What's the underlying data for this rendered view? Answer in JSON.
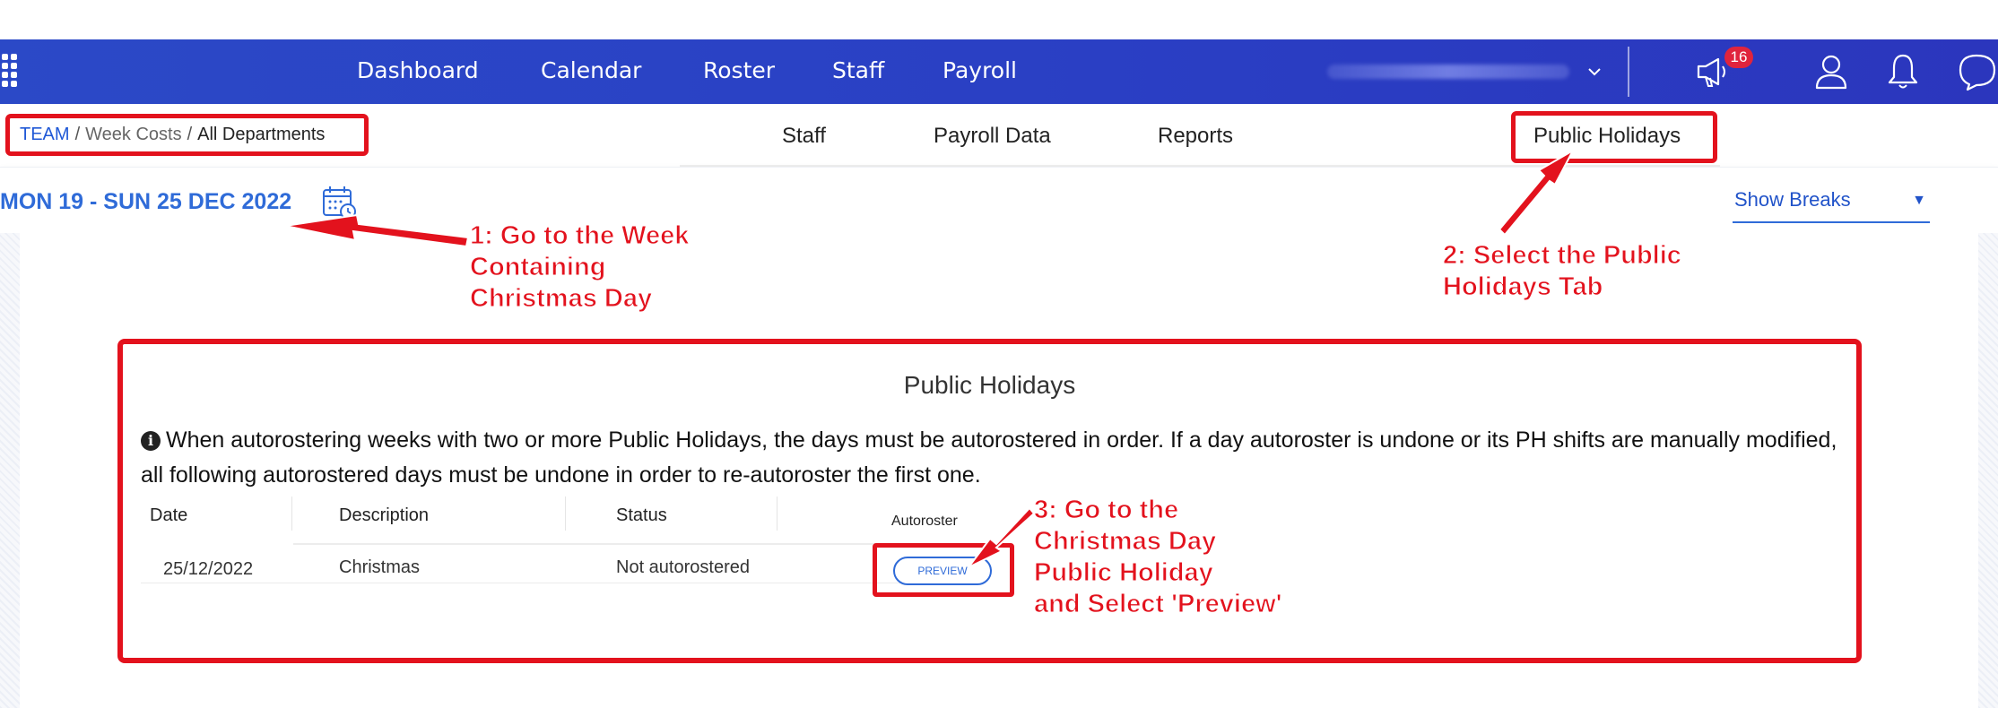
{
  "topbar": {
    "nav": [
      "Dashboard",
      "Calendar",
      "Roster",
      "Staff",
      "Payroll"
    ],
    "notification_count": "16"
  },
  "breadcrumb": {
    "team": "TEAM",
    "sep": "/",
    "middle": "Week Costs",
    "last": "All Departments"
  },
  "subtabs": [
    "Staff",
    "Payroll Data",
    "Reports",
    "Public Holidays"
  ],
  "datebar": {
    "week": "MON 19 - SUN 25 DEC 2022",
    "show_breaks": "Show Breaks",
    "caret": "▼"
  },
  "panel": {
    "title": "Public Holidays",
    "info": "When autorostering weeks with two or more Public Holidays, the days must be autorostered in order. If a day autoroster is undone or its PH shifts are manually modified, all following autorostered days must be undone in order to re-autoroster the first one.",
    "columns": [
      "Date",
      "Description",
      "Status"
    ],
    "autoroster_label": "Autoroster",
    "rows": [
      {
        "date": "25/12/2022",
        "description": "Christmas",
        "status": "Not autorostered",
        "action": "PREVIEW"
      }
    ]
  },
  "annotations": {
    "step1": [
      "1: Go to the Week",
      "Containing",
      "Christmas Day"
    ],
    "step2": [
      "2: Select the Public",
      "Holidays Tab"
    ],
    "step3": [
      "3: Go to the",
      "Christmas Day",
      "Public Holiday",
      "and Select 'Preview'"
    ]
  },
  "colors": {
    "topbar": "#2b3fc4",
    "accent_blue": "#2f6bd8",
    "annotation_red": "#e3121d",
    "badge_red": "#e0243d"
  },
  "icons": [
    "apps-grid-icon",
    "chevron-down-icon",
    "megaphone-icon",
    "user-icon",
    "bell-icon",
    "chat-icon",
    "calendar-clock-icon",
    "info-icon"
  ]
}
